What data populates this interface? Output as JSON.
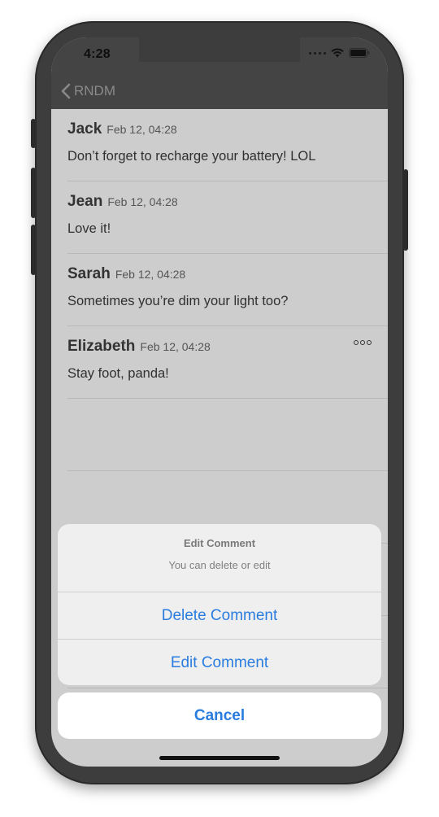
{
  "status_bar": {
    "time": "4:28"
  },
  "nav": {
    "back_label": "RNDM"
  },
  "comments": [
    {
      "name": "Jack",
      "date": "Feb 12, 04:28",
      "text": "Don’t forget to recharge your battery! LOL",
      "has_more": false
    },
    {
      "name": "Jean",
      "date": "Feb 12, 04:28",
      "text": "Love it!",
      "has_more": false
    },
    {
      "name": "Sarah",
      "date": "Feb 12, 04:28",
      "text": "Sometimes you’re dim your light too?",
      "has_more": false
    },
    {
      "name": "Elizabeth",
      "date": "Feb 12, 04:28",
      "text": "Stay foot, panda!",
      "has_more": true
    }
  ],
  "action_sheet": {
    "title": "Edit Comment",
    "message": "You can delete or edit",
    "actions": [
      "Delete Comment",
      "Edit Comment"
    ],
    "cancel": "Cancel"
  },
  "colors": {
    "accent": "#2a7ddf",
    "nav_bg": "#444444",
    "dim_bg": "#cdcdcd"
  },
  "icons": {
    "back": "chevron-left-icon",
    "more": "more-dots-icon",
    "wifi": "wifi-icon",
    "battery": "battery-icon"
  }
}
